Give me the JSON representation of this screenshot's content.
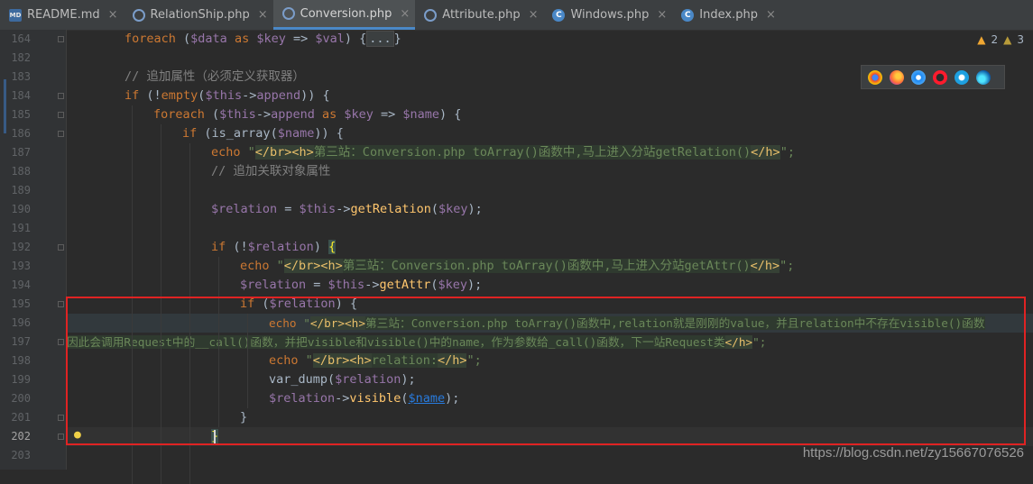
{
  "tabs": [
    {
      "label": "README.md",
      "icon": "markdown-file-icon",
      "active": false
    },
    {
      "label": "RelationShip.php",
      "icon": "php-file-icon",
      "active": false
    },
    {
      "label": "Conversion.php",
      "icon": "php-file-icon",
      "active": true
    },
    {
      "label": "Attribute.php",
      "icon": "php-file-icon",
      "active": false
    },
    {
      "label": "Windows.php",
      "icon": "class-file-icon",
      "active": false
    },
    {
      "label": "Index.php",
      "icon": "class-file-icon",
      "active": false
    }
  ],
  "tab_close_glyph": "×",
  "inspections": {
    "warnings": "2",
    "weak_warnings": "3"
  },
  "line_numbers": [
    "164",
    "182",
    "183",
    "184",
    "185",
    "186",
    "187",
    "188",
    "189",
    "190",
    "191",
    "192",
    "193",
    "194",
    "195",
    "196",
    "197",
    "198",
    "199",
    "200",
    "201",
    "202",
    "203"
  ],
  "code": {
    "l164": {
      "kw": "foreach",
      "a": " (",
      "v1": "$data",
      "as": " as ",
      "v2": "$key",
      "arrow": " => ",
      "v3": "$val",
      "b": ") {",
      "fold": "...",
      "c": "}"
    },
    "l183": "// 追加属性（必须定义获取器）",
    "l184": {
      "kw": "if",
      "a": " (!",
      "fn": "empty",
      "b": "(",
      "v": "$this",
      "c": "->",
      "p": "append",
      "d": ")) {"
    },
    "l185": {
      "kw": "foreach",
      "a": " (",
      "v1": "$this",
      "b": "->",
      "p": "append",
      "as": " as ",
      "v2": "$key",
      "arrow": " => ",
      "v3": "$name",
      "c": ") {"
    },
    "l186": {
      "kw": "if",
      "a": " (",
      "fn": "is_array",
      "b": "(",
      "v": "$name",
      "c": ")) {"
    },
    "l187": {
      "kw": "echo",
      "q1": " \"",
      "t1": "</br>",
      "t2": "<h>",
      "s": "第三站：Conversion.php toArray()函数中,马上进入分站getRelation()",
      "t3": "</h>",
      "q2": "\";"
    },
    "l188": "// 追加关联对象属性",
    "l190": {
      "v1": "$relation",
      "a": " = ",
      "v2": "$this",
      "b": "->",
      "fn": "getRelation",
      "c": "(",
      "v3": "$key",
      "d": ");"
    },
    "l192": {
      "kw": "if",
      "a": " (!",
      "v": "$relation",
      "b": ") ",
      "c": "{"
    },
    "l193": {
      "kw": "echo",
      "q1": " \"",
      "t1": "</br>",
      "t2": "<h>",
      "s": "第三站：Conversion.php toArray()函数中,马上进入分站getAttr()",
      "t3": "</h>",
      "q2": "\";"
    },
    "l194": {
      "v1": "$relation",
      "a": " = ",
      "v2": "$this",
      "b": "->",
      "fn": "getAttr",
      "c": "(",
      "v3": "$key",
      "d": ");"
    },
    "l195": {
      "kw": "if",
      "a": " (",
      "v": "$relation",
      "b": ") {"
    },
    "l196": {
      "kw": "echo",
      "q1": " \"",
      "t1": "</br>",
      "t2": "<h>",
      "s": "第三站：Conversion.php toArray()函数中,relation就是刚刚的value，并且relation中不存在visible()函数"
    },
    "l197": {
      "s": "因此会调用Request中的__call()函数，并把visible和visible()中的name，作为参数给_call()函数，下一站Request类",
      "t3": "</h>",
      "q2": "\";"
    },
    "l198": {
      "kw": "echo",
      "q1": " \"",
      "t1": "</br>",
      "t2": "<h>",
      "s": "relation:",
      "t3": "</h>",
      "q2": "\";"
    },
    "l199": {
      "fn": "var_dump",
      "a": "(",
      "v": "$relation",
      "b": ");"
    },
    "l200": {
      "v": "$relation",
      "a": "->",
      "fn": "visible",
      "b": "(",
      "v2": "$name",
      "c": ");"
    },
    "l201": "}",
    "l202": "}"
  },
  "watermark": "https://blog.csdn.net/zy15667076526",
  "colors": {
    "keyword": "#cc7832",
    "variable": "#9876aa",
    "string": "#6a8759",
    "function": "#ffc66d",
    "comment": "#808080",
    "highlight_box": "#e02323"
  }
}
